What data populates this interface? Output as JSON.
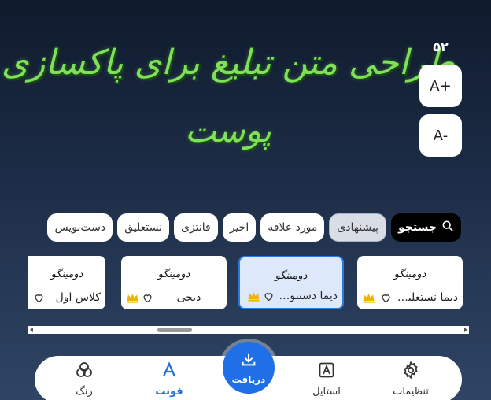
{
  "preview": {
    "line1": "طراحی متن تبلیغ برای پاکسازی",
    "line2": "پوست"
  },
  "font_size": {
    "value": "۵۲",
    "increase_label": "A+",
    "decrease_label": "A-"
  },
  "categories": [
    {
      "label": "جستجو",
      "icon": "search-icon"
    },
    {
      "label": "پیشنهادی"
    },
    {
      "label": "مورد علاقه"
    },
    {
      "label": "اخیر"
    },
    {
      "label": "فانتزی"
    },
    {
      "label": "نستعلیق"
    },
    {
      "label": "دست‌نویس"
    }
  ],
  "fonts": [
    {
      "sample": "دومینگو",
      "name": "دیما نستعلیق...",
      "premium": true
    },
    {
      "sample": "دومینگو",
      "name": "دیما دستنویس",
      "premium": true
    },
    {
      "sample": "دومینگو",
      "name": "دیجی",
      "premium": true
    },
    {
      "sample": "دومینگو",
      "name": "کلاس اول",
      "premium": false
    }
  ],
  "nav": {
    "settings": "تنظیمات",
    "style": "استایل",
    "download": "دریافت",
    "font": "فونت",
    "color": "رنگ"
  },
  "colors": {
    "accent": "#1f6fe6",
    "preview_text": "#7fe05a",
    "crown": "#f0b400"
  }
}
